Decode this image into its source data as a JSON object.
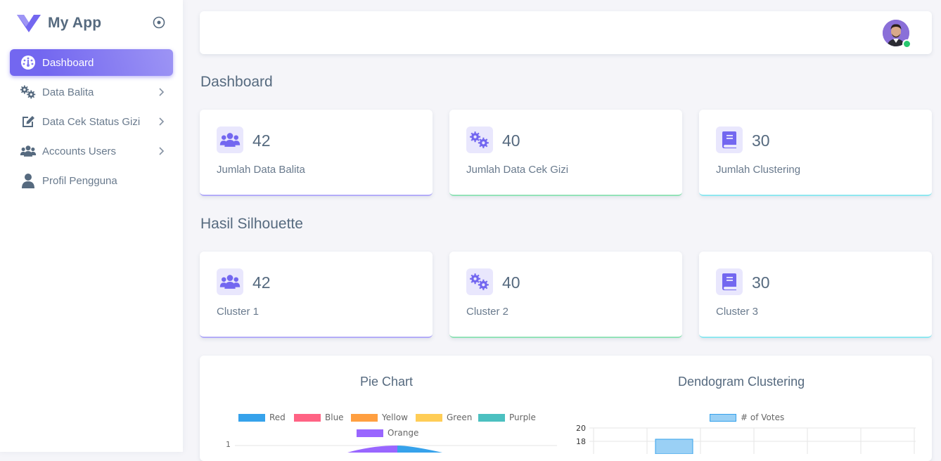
{
  "brand": {
    "name": "My App"
  },
  "sidebar": {
    "items": [
      {
        "label": "Dashboard",
        "icon": "dashboard-icon",
        "active": true
      },
      {
        "label": "Data Balita",
        "icon": "gears-icon",
        "has_submenu": true
      },
      {
        "label": "Data Cek Status Gizi",
        "icon": "edit-icon",
        "has_submenu": true
      },
      {
        "label": "Accounts Users",
        "icon": "users-icon",
        "has_submenu": true
      },
      {
        "label": "Profil Pengguna",
        "icon": "user-icon"
      }
    ]
  },
  "dashboard": {
    "title": "Dashboard",
    "cards": [
      {
        "value": "42",
        "label": "Jumlah Data Balita",
        "icon": "users-icon"
      },
      {
        "value": "40",
        "label": "Jumlah Data Cek Gizi",
        "icon": "gears-icon"
      },
      {
        "value": "30",
        "label": "Jumlah Clustering",
        "icon": "book-icon"
      }
    ]
  },
  "silhouette": {
    "title": "Hasil Silhouette",
    "cards": [
      {
        "value": "42",
        "label": "Cluster 1",
        "icon": "users-icon"
      },
      {
        "value": "40",
        "label": "Cluster 2",
        "icon": "gears-icon"
      },
      {
        "value": "30",
        "label": "Cluster 3",
        "icon": "book-icon"
      }
    ]
  },
  "colors": {
    "accent": "#7367f0",
    "icon_bg": "#e9e7fd",
    "online": "#28c76f"
  },
  "chart_data": [
    {
      "type": "pie",
      "title": "Pie Chart",
      "legend": [
        {
          "name": "Red",
          "color": "#36a2eb"
        },
        {
          "name": "Blue",
          "color": "#ff6384"
        },
        {
          "name": "Yellow",
          "color": "#ff9f40"
        },
        {
          "name": "Green",
          "color": "#ffcd56"
        },
        {
          "name": "Purple",
          "color": "#4bc0c0"
        },
        {
          "name": "Orange",
          "color": "#9966ff"
        }
      ],
      "visible_ticks": [
        "1"
      ]
    },
    {
      "type": "bar",
      "title": "Dendogram Clustering",
      "legend": [
        {
          "name": "# of Votes",
          "color": "#9ad0f5"
        }
      ],
      "visible_ticks": [
        "20",
        "18"
      ],
      "ylim": [
        0,
        20
      ]
    }
  ]
}
